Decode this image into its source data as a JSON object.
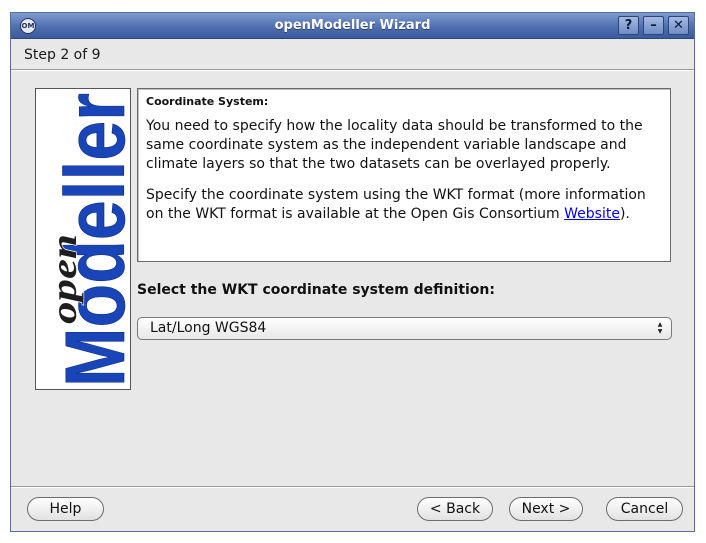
{
  "window": {
    "title": "openModeller Wizard",
    "icon_text": "OM",
    "controls": {
      "help": "?",
      "minimize": "–",
      "close": "✕"
    }
  },
  "step": {
    "label": "Step 2 of 9"
  },
  "logo": {
    "top": "open",
    "bottom": "Modeller"
  },
  "info": {
    "heading": "Coordinate System:",
    "para1": "You need to specify how the locality data should be transformed to the same coordinate system as the independent variable landscape and climate layers so that the two datasets can be overlayed properly.",
    "para2_prefix": "Specify the coordinate system using the WKT format (more information on the WKT format is available at the Open Gis Consortium ",
    "para2_link": "Website",
    "para2_suffix": ")."
  },
  "wkt": {
    "label": "Select the WKT coordinate system definition:",
    "selected": "Lat/Long WGS84"
  },
  "buttons": {
    "help": "Help",
    "back": "< Back",
    "next": "Next >",
    "cancel": "Cancel"
  },
  "colors": {
    "titlebar": "#4f6fb0",
    "logo_blue": "#1a45b8",
    "link": "#0000ee"
  }
}
